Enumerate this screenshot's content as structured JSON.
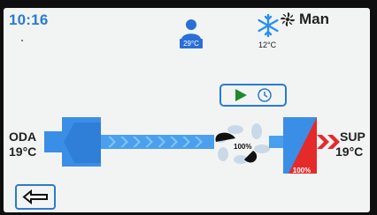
{
  "header": {
    "time": "10:16",
    "room_temp": "29°C",
    "cool_temp": "12°C",
    "mode": "Man"
  },
  "diagram": {
    "oda_label": "ODA",
    "oda_temp": "19°C",
    "sup_label": "SUP",
    "sup_temp": "19°C",
    "fan_percent": "100%",
    "heater_percent": "100%"
  },
  "icons": [
    "person-icon",
    "snowflake-icon",
    "fan-mode-icon",
    "play-icon",
    "timer-icon",
    "arrow-left-icon"
  ],
  "colors": {
    "accent_blue": "#2a7bd0",
    "heater_red": "#e52a2a",
    "play_green": "#1f8a2b"
  }
}
